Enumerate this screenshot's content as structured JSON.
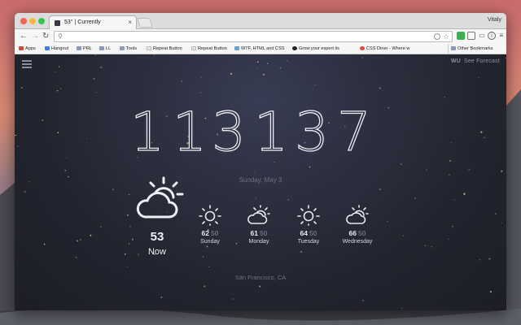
{
  "browser": {
    "tab_title": "53° | Currently",
    "user_name": "Vitaly",
    "bookmarks": [
      {
        "label": "Apps",
        "icon": "apps-grid-icon",
        "color": "#d84a38"
      },
      {
        "label": "Hangout",
        "icon": "hangouts-icon",
        "color": "#3a7fe0"
      },
      {
        "label": "PRL",
        "icon": "folder-icon",
        "color": "#8a9bb8"
      },
      {
        "label": "LL",
        "icon": "folder-icon",
        "color": "#8a9bb8"
      },
      {
        "label": "Tools",
        "icon": "folder-icon",
        "color": "#8a9bb8"
      },
      {
        "label": "Repeat Button",
        "icon": "page-icon",
        "color": "#cfcfcf"
      },
      {
        "label": "Repeat Button",
        "icon": "page-icon",
        "color": "#cfcfcf"
      },
      {
        "label": "WTF, HTML and CSS",
        "icon": "wtf-icon",
        "color": "#6aa0d8"
      },
      {
        "label": "Grow your expert lis",
        "icon": "grow-icon",
        "color": "#222222"
      },
      {
        "label": "CSS Diner - Where w",
        "icon": "css-diner-icon",
        "color": "#e0463c"
      },
      {
        "label": "Other Bookmarks",
        "icon": "folder-icon",
        "color": "#8a9bb8"
      }
    ]
  },
  "app": {
    "brand": "WU",
    "see_forecast": "See Forecast",
    "time": {
      "hours": "11",
      "minutes": "31",
      "seconds": "37"
    },
    "date": "Sunday, May 3",
    "current": {
      "temp": "53",
      "label": "Now",
      "icon": "partly-cloudy-icon"
    },
    "forecast": [
      {
        "high": "62",
        "low": "50",
        "day": "Sunday",
        "icon": "sun-icon"
      },
      {
        "high": "61",
        "low": "50",
        "day": "Monday",
        "icon": "partly-cloudy-icon"
      },
      {
        "high": "64",
        "low": "50",
        "day": "Tuesday",
        "icon": "sun-icon"
      },
      {
        "high": "66",
        "low": "50",
        "day": "Wednesday",
        "icon": "partly-cloudy-icon"
      }
    ],
    "location": "San Francisco, CA"
  },
  "colors": {
    "background": "#23252f",
    "text": "#e9eaf0",
    "muted": "#6e7080"
  }
}
